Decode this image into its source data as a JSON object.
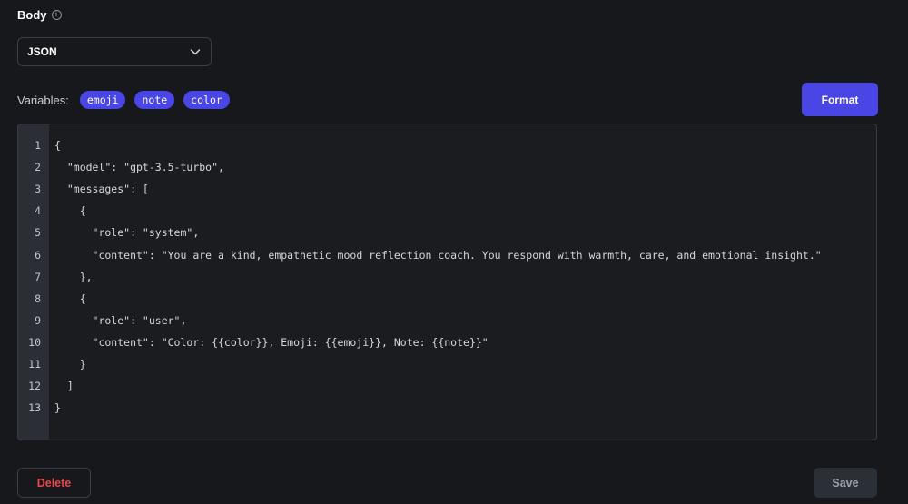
{
  "body_section": {
    "label": "Body",
    "info_icon": "ⓘ",
    "select_value": "JSON"
  },
  "variables": {
    "label": "Variables:",
    "chips": [
      "emoji",
      "note",
      "color"
    ]
  },
  "format_button": "Format",
  "editor": {
    "line_numbers": [
      "1",
      "2",
      "3",
      "4",
      "5",
      "6",
      "7",
      "8",
      "9",
      "10",
      "11",
      "12",
      "13"
    ],
    "lines": [
      "{",
      "  \"model\": \"gpt-3.5-turbo\",",
      "  \"messages\": [",
      "    {",
      "      \"role\": \"system\",",
      "      \"content\": \"You are a kind, empathetic mood reflection coach. You respond with warmth, care, and emotional insight.\"",
      "    },",
      "    {",
      "      \"role\": \"user\",",
      "      \"content\": \"Color: {{color}}, Emoji: {{emoji}}, Note: {{note}}\"",
      "    }",
      "  ]",
      "}"
    ]
  },
  "actions": {
    "delete": "Delete",
    "save": "Save"
  },
  "colors": {
    "background": "#16181c",
    "accent": "#4a46e6",
    "danger": "#e5484d",
    "gutter": "#2b2e34"
  }
}
